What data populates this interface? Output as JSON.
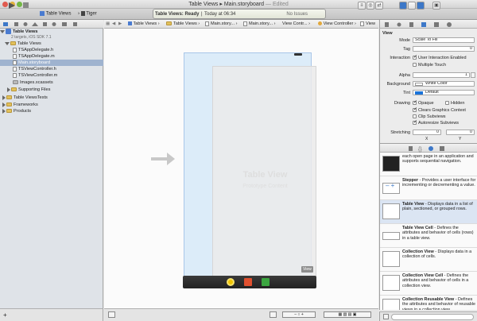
{
  "window": {
    "title": "Table Views",
    "file": "Main.storyboard",
    "edited": "— Edited"
  },
  "toolbar": {
    "scheme": "Table Views",
    "device": "Tiger",
    "status": "Table Views: Ready",
    "time": "Today at 06:34",
    "issues": "No Issues"
  },
  "navigator": {
    "project": "Table Views",
    "project_sub": "2 targets, iOS SDK 7.1",
    "items": [
      {
        "label": "Table Views",
        "kind": "folder"
      },
      {
        "label": "TSAppDelegate.h",
        "kind": "file"
      },
      {
        "label": "TSAppDelegate.m",
        "kind": "file"
      },
      {
        "label": "Main.storyboard",
        "kind": "file"
      },
      {
        "label": "TSViewController.h",
        "kind": "file"
      },
      {
        "label": "TSViewController.m",
        "kind": "file"
      },
      {
        "label": "Images.xcassets",
        "kind": "file"
      },
      {
        "label": "Supporting Files",
        "kind": "folder"
      },
      {
        "label": "Table ViewsTests",
        "kind": "folder"
      },
      {
        "label": "Frameworks",
        "kind": "folder"
      },
      {
        "label": "Products",
        "kind": "folder"
      }
    ]
  },
  "jumpbar": {
    "crumbs": [
      "Table Views",
      "Table Views",
      "Main.story...",
      "Main.story...",
      "View Contr...",
      "View Controller",
      "View"
    ]
  },
  "canvas": {
    "tv_title": "Table View",
    "tv_sub": "Prototype Content",
    "view_badge": "View"
  },
  "inspector": {
    "header": "View",
    "mode_label": "Mode",
    "mode_value": "Scale To Fill",
    "tag_label": "Tag",
    "tag_value": "0",
    "interaction_label": "Interaction",
    "uie": "User Interaction Enabled",
    "mt": "Multiple Touch",
    "alpha_label": "Alpha",
    "alpha_value": "1",
    "bg_label": "Background",
    "bg_value": "White Color",
    "tint_label": "Tint",
    "tint_value": "Default",
    "drawing_label": "Drawing",
    "opaque": "Opaque",
    "hidden": "Hidden",
    "clears": "Clears Graphics Context",
    "clip": "Clip Subviews",
    "autoresize": "Autoresize Subviews",
    "stretching_label": "Stretching",
    "s_x": "0",
    "s_y": "0",
    "x_label": "X",
    "y_label": "Y"
  },
  "library": {
    "items": [
      {
        "title": "",
        "desc": "each open page in an application and supports sequential navigation."
      },
      {
        "title": "Stepper",
        "desc": " - Provides a user interface for incrementing or decrementing a value."
      },
      {
        "title": "Table View",
        "desc": " - Displays data in a list of plain, sectioned, or grouped rows."
      },
      {
        "title": "Table View Cell",
        "desc": " - Defines the attributes and behavior of cells (rows) in a table view."
      },
      {
        "title": "Collection View",
        "desc": " - Displays data in a collection of cells."
      },
      {
        "title": "Collection View Cell",
        "desc": " - Defines the attributes and behavior of cells in a collection view."
      },
      {
        "title": "Collection Reusable View",
        "desc": " - Defines the attributes and behavior of reusable views in a collection view..."
      }
    ]
  }
}
